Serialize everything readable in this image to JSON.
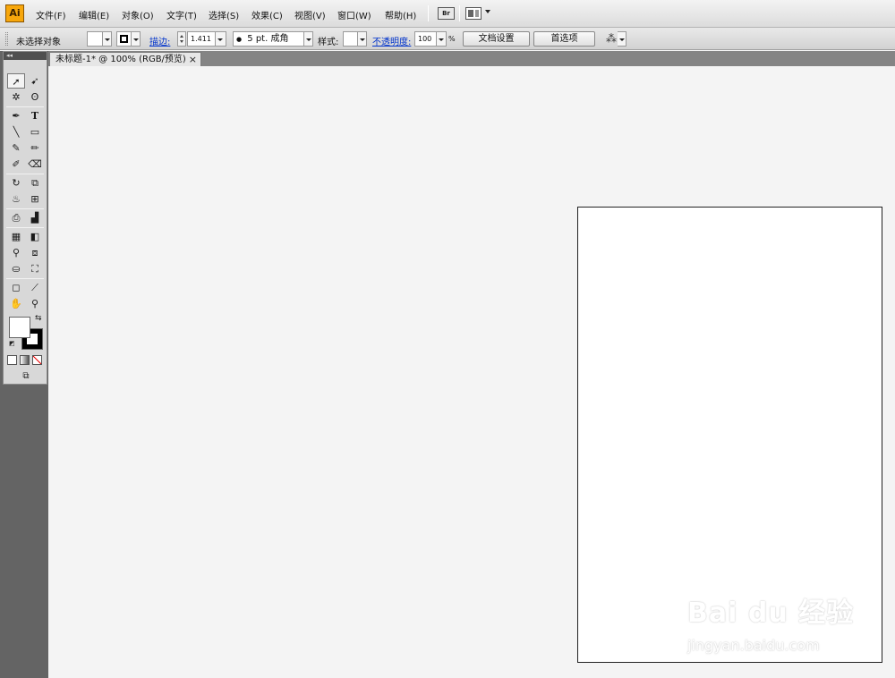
{
  "app": {
    "logo": "Ai"
  },
  "menu": {
    "items": [
      "文件(F)",
      "编辑(E)",
      "对象(O)",
      "文字(T)",
      "选择(S)",
      "效果(C)",
      "视图(V)",
      "窗口(W)",
      "帮助(H)"
    ],
    "bridge_label": "Br"
  },
  "control": {
    "selection_status": "未选择对象",
    "stroke_label": "描边:",
    "stroke_weight": "1.411",
    "brush": "5 pt. 成角",
    "style_label": "样式:",
    "opacity_label": "不透明度:",
    "opacity_value": "100",
    "opacity_unit": "%",
    "doc_setup_button": "文档设置",
    "preferences_button": "首选项"
  },
  "toolbox": {
    "collapse_label": "◂◂"
  },
  "document": {
    "tab_title": "未标题-1* @ 100% (RGB/预览)",
    "tab_close": "×"
  },
  "watermark": {
    "logo_text": "Bai du 经验",
    "url": "jingyan.baidu.com"
  },
  "colors": {
    "fill": "#ffffff",
    "stroke": "#000000",
    "artboard": "#ffffff",
    "canvas": "#f4f4f4",
    "toolbox": "#646464"
  }
}
